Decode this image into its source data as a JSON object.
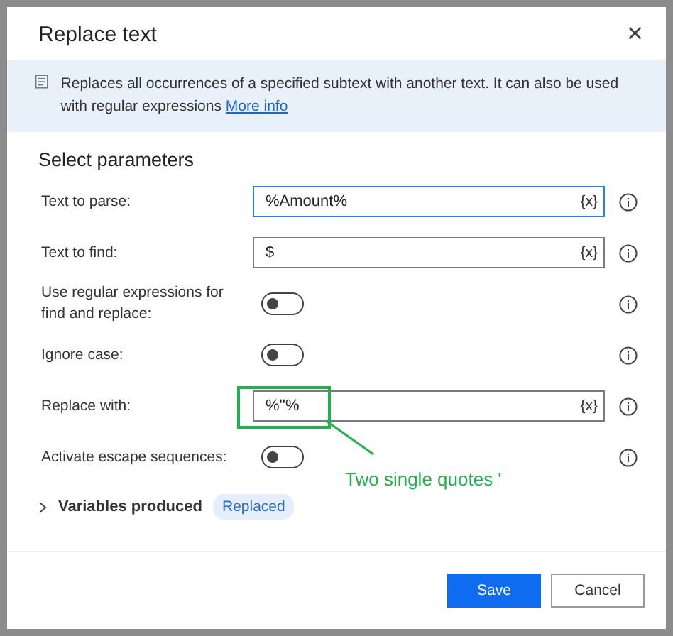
{
  "dialog": {
    "title": "Replace text",
    "close": "×"
  },
  "banner": {
    "text": "Replaces all occurrences of a specified subtext with another text. It can also be used with regular expressions",
    "link": "More info"
  },
  "section_title": "Select parameters",
  "parameters": [
    {
      "kind": "field",
      "label": "Text to parse:",
      "value": "%Amount%",
      "focused": true,
      "var_button": "{x}"
    },
    {
      "kind": "field",
      "label": "Text to find:",
      "value": "$",
      "focused": false,
      "var_button": "{x}"
    },
    {
      "kind": "toggle",
      "label": "Use regular expressions for find and replace:",
      "on": false
    },
    {
      "kind": "toggle",
      "label": "Ignore case:",
      "on": false
    },
    {
      "kind": "field",
      "label": "Replace with:",
      "value": "%''%",
      "focused": false,
      "var_button": "{x}"
    },
    {
      "kind": "toggle",
      "label": "Activate escape sequences:",
      "on": false
    }
  ],
  "variables": {
    "label": "Variables produced",
    "expanded": false,
    "chips": [
      "Replaced"
    ]
  },
  "buttons": [
    {
      "label": "Save",
      "kind": "primary"
    },
    {
      "label": "Cancel",
      "kind": "secondary"
    }
  ],
  "annotation": {
    "text": "Two single quotes '"
  }
}
